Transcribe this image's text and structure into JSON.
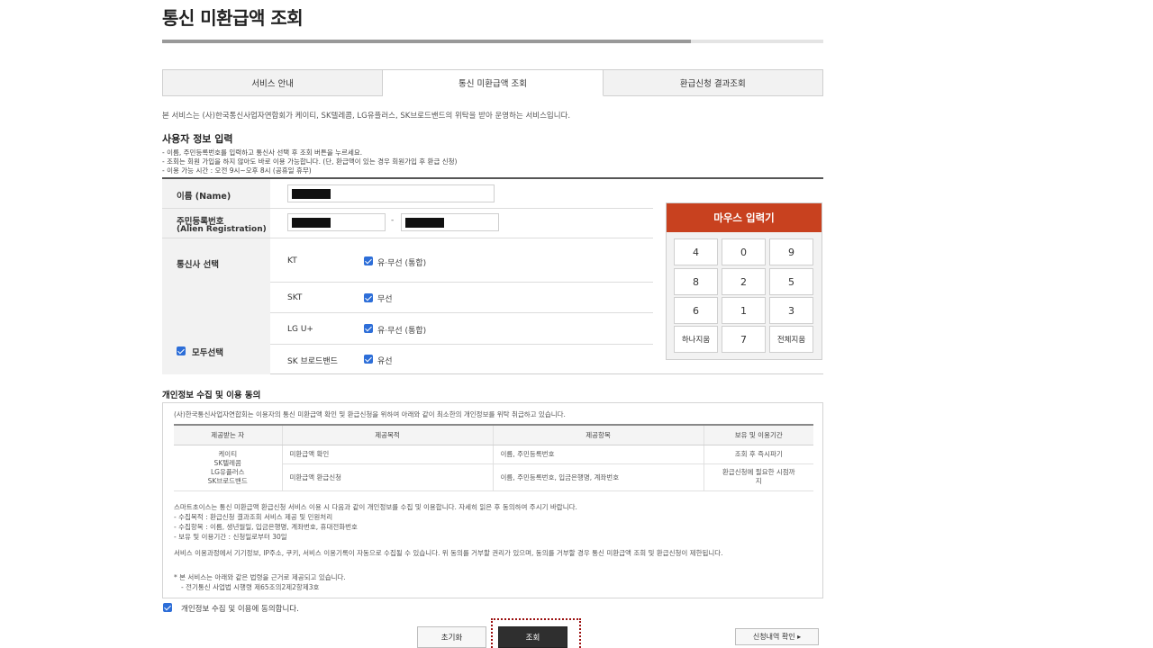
{
  "page": {
    "title": "통신 미환급액 조회",
    "progress_fraction": 0.8
  },
  "tabs": [
    {
      "label": "서비스 안내",
      "active": false
    },
    {
      "label": "통신 미환급액 조회",
      "active": true
    },
    {
      "label": "환급신청 결과조회",
      "active": false
    }
  ],
  "intro": "본 서비스는 (사)한국통신사업자연합회가 케이티, SK텔레콤, LG유플러스, SK브로드밴드의 위탁을 받아 운영하는 서비스입니다.",
  "user_info": {
    "title": "사용자 정보 입력",
    "notes": [
      "- 이름, 주민등록번호를 입력하고 통신사 선택 후 조회 버튼을 누르세요.",
      "- 조회는 회원 가입을 하지 않아도 바로 이용 가능합니다. (단, 환급액이 있는 경우 회원가입 후 환급 신청)",
      "- 이용 가능 시간 : 오전 9시~오후 8시 (공휴일 휴무)"
    ],
    "name_label": "이름 (Name)",
    "rrn_label_line1": "주민등록번호",
    "rrn_label_line2": "(Alien Registration)",
    "rrn_separator": "-",
    "carrier_label": "통신사 선택",
    "select_all_label": "모두선택",
    "carriers": [
      {
        "name": "KT",
        "option": "유·무선 (통합)",
        "checked": true
      },
      {
        "name": "SKT",
        "option": "무선",
        "checked": true
      },
      {
        "name": "LG U+",
        "option": "유·무선 (통합)",
        "checked": true
      },
      {
        "name": "SK 브로드밴드",
        "option": "유선",
        "checked": true
      }
    ]
  },
  "keypad": {
    "title": "마우스 입력기",
    "keys": [
      "4",
      "0",
      "9",
      "8",
      "2",
      "5",
      "6",
      "1",
      "3",
      "하나지움",
      "7",
      "전체지움"
    ]
  },
  "consent": {
    "title": "개인정보 수집 및 이용 동의",
    "lead": "(사)한국통신사업자연합회는 이용자의 통신 미환급액 확인 및 환급신청을 위하여 아래와 같이 최소한의 개인정보를 위탁 취급하고 있습니다.",
    "headers": [
      "제공받는 자",
      "제공목적",
      "제공항목",
      "보유 및 이용기간"
    ],
    "recipients": [
      "케이티",
      "SK텔레콤",
      "LG유플러스",
      "SK브로드밴드"
    ],
    "rows": [
      {
        "purpose": "미환급액 확인",
        "items": "이름, 주민등록번호",
        "period": "조회 후 즉시파기"
      },
      {
        "purpose": "미환급액 환급신청",
        "items": "이름, 주민등록번호, 입금은행명, 계좌번호",
        "period": "환급신청에 필요한 시점까지"
      }
    ],
    "para1": [
      "스마트초이스는 통신 미환급액 환급신청 서비스 이용 시 다음과 같이 개인정보를 수집 및 이용합니다. 자세히 읽은 후 동의하여 주시기 바랍니다.",
      "- 수집목적 : 환급신청 결과조회 서비스 제공 및 민원처리",
      "- 수집항목 : 이름, 생년월일, 입금은행명, 계좌번호, 휴대전화번호",
      "- 보유 및 이용기간 : 신청일로부터 30일"
    ],
    "para2": "서비스 이용과정에서 기기정보, IP주소, 쿠키, 서비스 이용기록이 자동으로 수집될 수 있습니다. 위 동의를 거부할 권리가 있으며, 동의를 거부할 경우 통신 미환급액 조회 및 환급신청이 제한됩니다.",
    "para3": [
      "* 본 서비스는 아래와 같은 법령을 근거로 제공되고 있습니다.",
      "- 전기통신 사업법 시행령 제65조의2제2항제3호"
    ],
    "agree_label": "개인정보 수집 및 이용에 동의합니다.",
    "agree_checked": true
  },
  "buttons": {
    "reset": "초기화",
    "search": "조회",
    "history": "신청내역 확인 ▸"
  },
  "colors": {
    "accent": "#c8411f",
    "checkbox": "#2d6ed8",
    "primary_button": "#2f2f2f",
    "focus_ring": "#9b0f0f"
  }
}
